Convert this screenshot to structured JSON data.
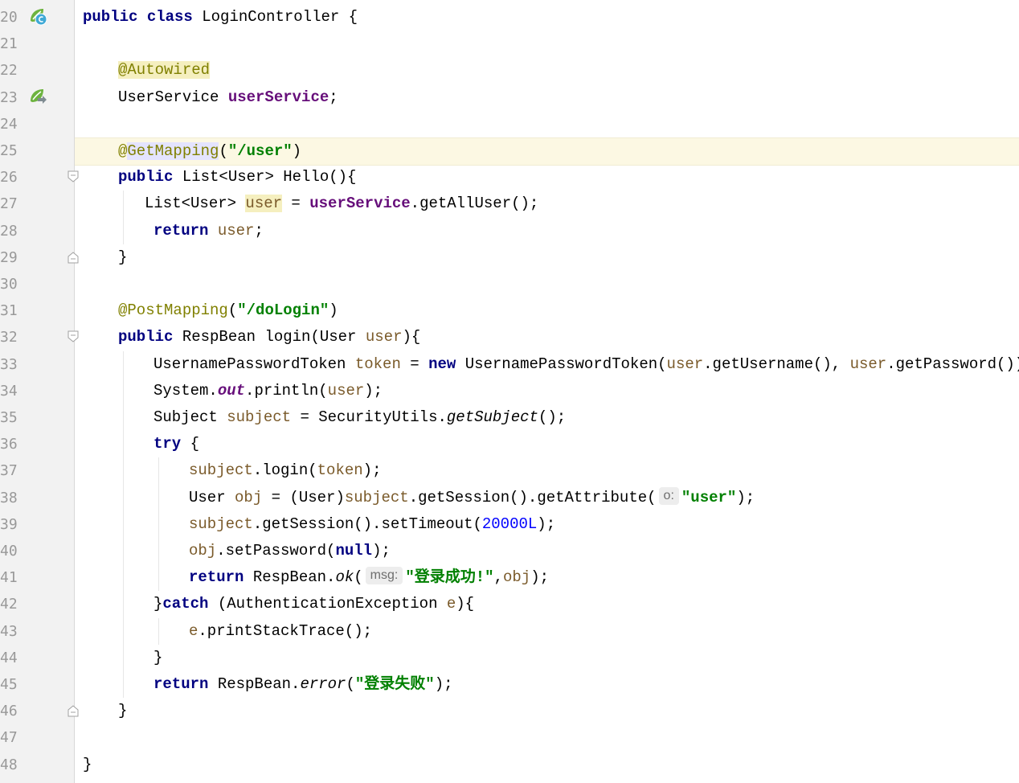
{
  "editor": {
    "current_line": 25,
    "lines": [
      {
        "n": "20",
        "tokens": [
          [
            "kw",
            "public"
          ],
          [
            "t",
            " "
          ],
          [
            "kw",
            "class"
          ],
          [
            "t",
            " LoginController {"
          ]
        ]
      },
      {
        "n": "21",
        "tokens": []
      },
      {
        "n": "22",
        "tokens": [
          [
            "ann hl-ann",
            "@Autowired"
          ]
        ]
      },
      {
        "n": "23",
        "tokens": [
          [
            "t",
            "UserService "
          ],
          [
            "field",
            "userService"
          ],
          [
            "t",
            ";"
          ]
        ]
      },
      {
        "n": "24",
        "tokens": []
      },
      {
        "n": "25",
        "tokens": [
          [
            "ann",
            "@"
          ],
          [
            "ann hl-ident",
            "GetMapping"
          ],
          [
            "t",
            "("
          ],
          [
            "str",
            "\"/user\""
          ],
          [
            "t",
            ")"
          ]
        ]
      },
      {
        "n": "26",
        "tokens": [
          [
            "kw",
            "public"
          ],
          [
            "t",
            " List<User> Hello(){"
          ]
        ]
      },
      {
        "n": "27",
        "tokens": [
          [
            "t",
            "List<User> "
          ],
          [
            "var hl-var",
            "user"
          ],
          [
            "t",
            " = "
          ],
          [
            "field",
            "userService"
          ],
          [
            "t",
            ".getAllUser();"
          ]
        ]
      },
      {
        "n": "28",
        "tokens": [
          [
            "kw",
            "return"
          ],
          [
            "t",
            " "
          ],
          [
            "var",
            "user"
          ],
          [
            "t",
            ";"
          ]
        ]
      },
      {
        "n": "29",
        "tokens": [
          [
            "t",
            "}"
          ]
        ]
      },
      {
        "n": "30",
        "tokens": []
      },
      {
        "n": "31",
        "tokens": [
          [
            "ann",
            "@PostMapping"
          ],
          [
            "t",
            "("
          ],
          [
            "str",
            "\"/doLogin\""
          ],
          [
            "t",
            ")"
          ]
        ]
      },
      {
        "n": "32",
        "tokens": [
          [
            "kw",
            "public"
          ],
          [
            "t",
            " RespBean login(User "
          ],
          [
            "var",
            "user"
          ],
          [
            "t",
            "){"
          ]
        ]
      },
      {
        "n": "33",
        "tokens": [
          [
            "t",
            "UsernamePasswordToken "
          ],
          [
            "var",
            "token"
          ],
          [
            "t",
            " = "
          ],
          [
            "kw",
            "new"
          ],
          [
            "t",
            " UsernamePasswordToken("
          ],
          [
            "var",
            "user"
          ],
          [
            "t",
            ".getUsername(), "
          ],
          [
            "var",
            "user"
          ],
          [
            "t",
            ".getPassword());"
          ]
        ]
      },
      {
        "n": "34",
        "tokens": [
          [
            "t",
            "System."
          ],
          [
            "static-field",
            "out"
          ],
          [
            "t",
            ".println("
          ],
          [
            "var",
            "user"
          ],
          [
            "t",
            ");"
          ]
        ]
      },
      {
        "n": "35",
        "tokens": [
          [
            "t",
            "Subject "
          ],
          [
            "var",
            "subject"
          ],
          [
            "t",
            " = SecurityUtils."
          ],
          [
            "italic",
            "getSubject"
          ],
          [
            "t",
            "();"
          ]
        ]
      },
      {
        "n": "36",
        "tokens": [
          [
            "kw",
            "try"
          ],
          [
            "t",
            " {"
          ]
        ]
      },
      {
        "n": "37",
        "tokens": [
          [
            "var",
            "subject"
          ],
          [
            "t",
            ".login("
          ],
          [
            "var",
            "token"
          ],
          [
            "t",
            ");"
          ]
        ]
      },
      {
        "n": "38",
        "tokens": [
          [
            "t",
            "User "
          ],
          [
            "var",
            "obj"
          ],
          [
            "t",
            " = (User)"
          ],
          [
            "var",
            "subject"
          ],
          [
            "t",
            ".getSession().getAttribute("
          ],
          [
            "hint",
            "o:"
          ],
          [
            "str",
            "\"user\""
          ],
          [
            "t",
            ");"
          ]
        ]
      },
      {
        "n": "39",
        "tokens": [
          [
            "var",
            "subject"
          ],
          [
            "t",
            ".getSession().setTimeout("
          ],
          [
            "num",
            "20000L"
          ],
          [
            "t",
            ");"
          ]
        ]
      },
      {
        "n": "40",
        "tokens": [
          [
            "var",
            "obj"
          ],
          [
            "t",
            ".setPassword("
          ],
          [
            "kw",
            "null"
          ],
          [
            "t",
            ");"
          ]
        ]
      },
      {
        "n": "41",
        "tokens": [
          [
            "kw",
            "return"
          ],
          [
            "t",
            " RespBean."
          ],
          [
            "italic",
            "ok"
          ],
          [
            "t",
            "("
          ],
          [
            "hint",
            "msg:"
          ],
          [
            "str",
            "\"登录成功!\""
          ],
          [
            "t",
            ","
          ],
          [
            "var",
            "obj"
          ],
          [
            "t",
            ");"
          ]
        ]
      },
      {
        "n": "42",
        "tokens": [
          [
            "t",
            "}"
          ],
          [
            "kw",
            "catch"
          ],
          [
            "t",
            " (AuthenticationException "
          ],
          [
            "var",
            "e"
          ],
          [
            "t",
            "){"
          ]
        ]
      },
      {
        "n": "43",
        "tokens": [
          [
            "var",
            "e"
          ],
          [
            "t",
            ".printStackTrace();"
          ]
        ]
      },
      {
        "n": "44",
        "tokens": [
          [
            "t",
            "}"
          ]
        ]
      },
      {
        "n": "45",
        "tokens": [
          [
            "kw",
            "return"
          ],
          [
            "t",
            " RespBean."
          ],
          [
            "italic",
            "error"
          ],
          [
            "t",
            "("
          ],
          [
            "str",
            "\"登录失败\""
          ],
          [
            "t",
            ");"
          ]
        ]
      },
      {
        "n": "46",
        "tokens": [
          [
            "t",
            "}"
          ]
        ]
      },
      {
        "n": "47",
        "tokens": []
      },
      {
        "n": "48",
        "tokens": [
          [
            "t",
            "}"
          ]
        ]
      }
    ]
  },
  "gutter_icons": {
    "line20": "spring-bean-class-icon",
    "line23": "spring-autowired-navigate-icon"
  },
  "fold_markers": {
    "open": [
      "26",
      "32"
    ],
    "close": [
      "29",
      "46"
    ]
  },
  "colors": {
    "keyword": "#000080",
    "annotation": "#808000",
    "field": "#660e7a",
    "string": "#008000",
    "local_var": "#7a5a2a",
    "number": "#0000ff",
    "current_line_bg": "#fcf8e3",
    "gutter_bg": "#f2f2f2"
  }
}
